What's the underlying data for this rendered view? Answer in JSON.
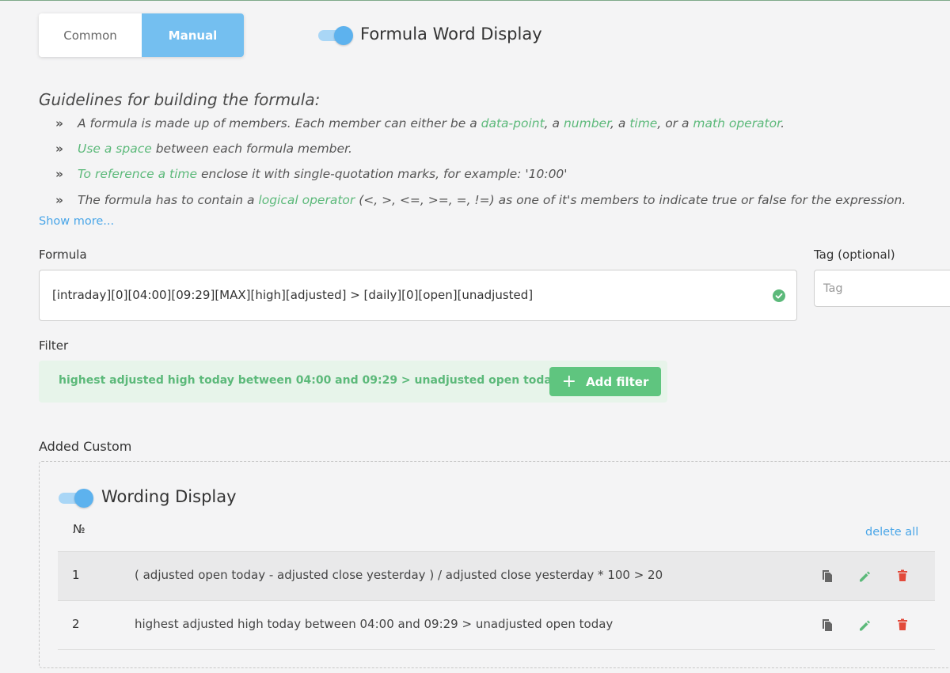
{
  "tabs": {
    "common": "Common",
    "manual": "Manual"
  },
  "formula_word_display": {
    "label": "Formula Word Display",
    "enabled": true
  },
  "guidelines": {
    "title": "Guidelines for building the formula:",
    "item1": {
      "p1": "A formula is made up of members. Each member can either be a ",
      "l1": "data-point",
      "p2": ", a ",
      "l2": "number",
      "p3": ", a ",
      "l3": "time",
      "p4": ", or a ",
      "l4": "math operator",
      "p5": "."
    },
    "item2": {
      "l1": "Use a space",
      "p1": " between each formula member."
    },
    "item3": {
      "l1": "To reference a time",
      "p1": " enclose it with single-quotation marks, for example: '10:00'"
    },
    "item4": {
      "p1": "The formula has to contain a ",
      "l1": "logical operator",
      "p2": " (<, >, <=, >=, =, !=) as one of it's members to indicate true or false for the expression."
    },
    "show_more": "Show more..."
  },
  "formula": {
    "label": "Formula",
    "value": "[intraday][0][04:00][09:29][MAX][high][adjusted] > [daily][0][open][unadjusted]"
  },
  "tag": {
    "label": "Tag (optional)",
    "placeholder": "Tag"
  },
  "filter": {
    "label": "Filter",
    "text": "highest adjusted high today between 04:00 and 09:29 > unadjusted open today",
    "add_button": "Add filter"
  },
  "added_custom": {
    "title": "Added Custom",
    "wording_display": {
      "label": "Wording Display",
      "enabled": true
    },
    "column_no": "№",
    "delete_all": "delete all",
    "rows": [
      {
        "no": "1",
        "text": "( adjusted open today - adjusted close yesterday ) / adjusted close yesterday * 100 > 20"
      },
      {
        "no": "2",
        "text": "highest adjusted high today between 04:00 and 09:29 > unadjusted open today"
      }
    ]
  },
  "colors": {
    "accent_blue": "#74bff0",
    "green": "#5cb97a",
    "delete_red": "#e24a3b"
  }
}
